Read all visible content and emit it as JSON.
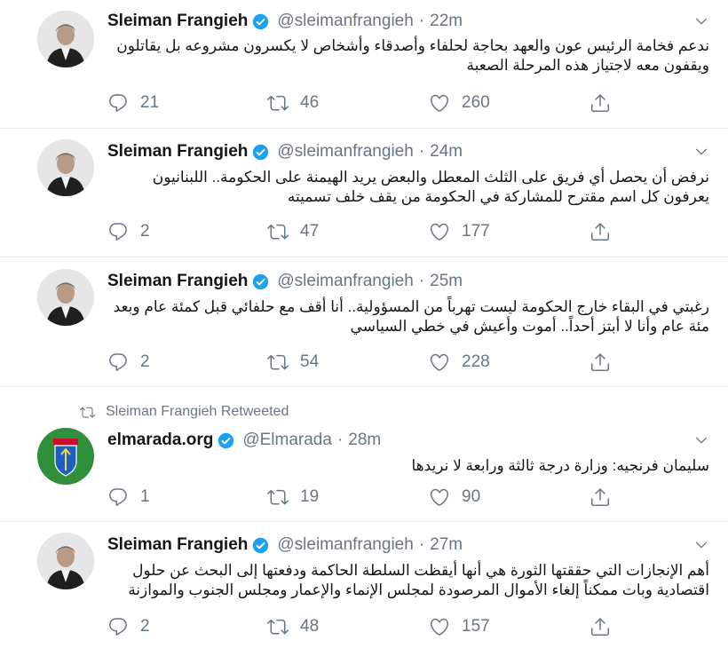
{
  "tweets": [
    {
      "name": "Sleiman Frangieh",
      "handle": "@sleimanfrangieh",
      "time": "22m",
      "text": "ندعم فخامة الرئيس عون والعهد بحاجة لحلفاء وأصدقاء وأشخاص لا يكسرون مشروعه بل يقاتلون ويقفون معه لاجتياز هذه المرحلة الصعبة",
      "replies": "21",
      "retweets": "46",
      "likes": "260"
    },
    {
      "name": "Sleiman Frangieh",
      "handle": "@sleimanfrangieh",
      "time": "24m",
      "text": "نرفض أن يحصل أي فريق على الثلث المعطل والبعض يريد الهيمنة على الحكومة.. اللبنانيون يعرفون كل اسم مقترح للمشاركة في الحكومة من يقف خلف تسميته",
      "replies": "2",
      "retweets": "47",
      "likes": "177"
    },
    {
      "name": "Sleiman Frangieh",
      "handle": "@sleimanfrangieh",
      "time": "25m",
      "text": "رغبتي في البقاء خارج الحكومة ليست تهرباً من المسؤولية.. أنا أقف مع حلفائي قبل كمئة عام وبعد مئة عام وأنا لا أبتز أحداً.. أموت وأعيش في خطي السياسي",
      "replies": "2",
      "retweets": "54",
      "likes": "228"
    },
    {
      "retweeted_by": "Sleiman Frangieh Retweeted",
      "name": "elmarada.org",
      "handle": "@Elmarada",
      "time": "28m",
      "text": "سليمان فرنجيه: وزارة درجة ثالثة ورابعة لا نريدها",
      "replies": "1",
      "retweets": "19",
      "likes": "90"
    },
    {
      "name": "Sleiman Frangieh",
      "handle": "@sleimanfrangieh",
      "time": "27m",
      "text": "أهم الإنجازات التي حققتها الثورة هي أنها أيقظت السلطة الحاكمة ودفعتها إلى البحث عن حلول اقتصادية وبات ممكناً إلغاء الأموال المرصودة لمجلس الإنماء والإعمار ومجلس الجنوب والموازنة",
      "replies": "2",
      "retweets": "48",
      "likes": "157"
    }
  ],
  "colors": {
    "verified": "#1da1f2",
    "muted": "#657786",
    "text": "#14171a"
  },
  "icons": [
    "reply-icon",
    "retweet-icon",
    "like-icon",
    "share-icon",
    "verified-icon",
    "chevron-down-icon"
  ]
}
